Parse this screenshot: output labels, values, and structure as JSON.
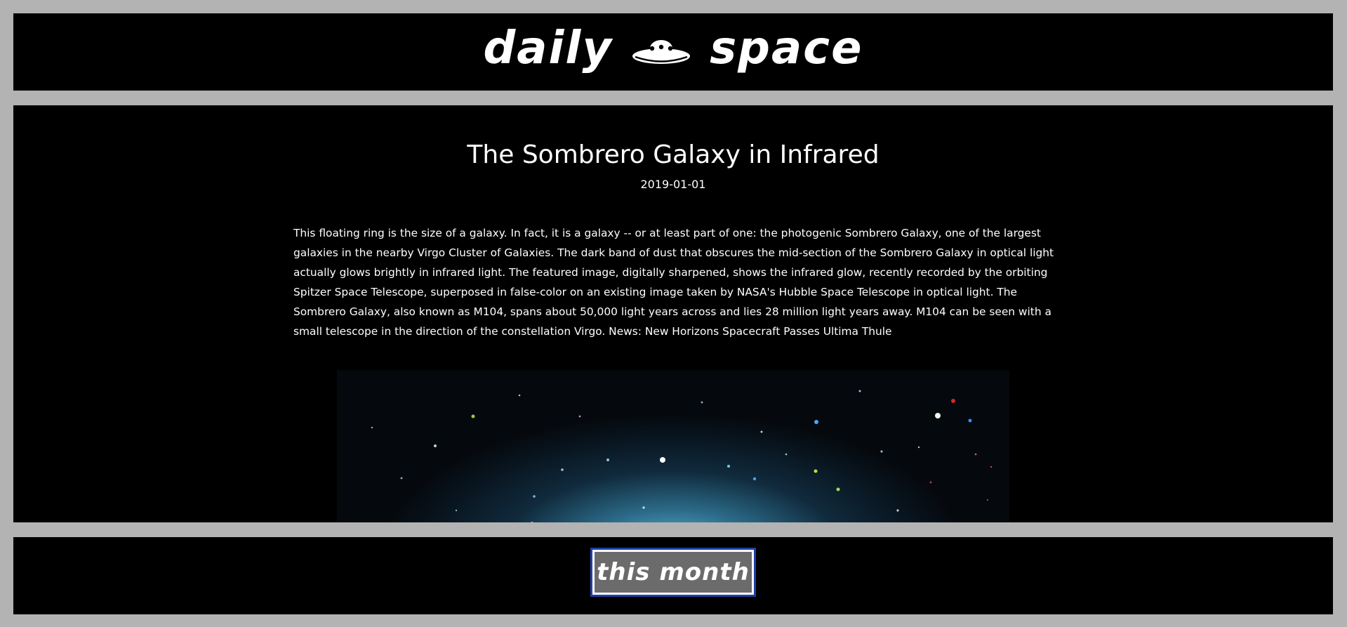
{
  "header": {
    "logo_left": "daily",
    "logo_icon": "ufo-icon",
    "logo_right": "space"
  },
  "article": {
    "title": "The Sombrero Galaxy in Infrared",
    "date": "2019-01-01",
    "explanation": "This floating ring is the size of a galaxy. In fact, it is a galaxy -- or at least part of one: the photogenic Sombrero Galaxy, one of the largest galaxies in the nearby Virgo Cluster of Galaxies. The dark band of dust that obscures the mid-section of the Sombrero Galaxy in optical light actually glows brightly in infrared light. The featured image, digitally sharpened, shows the infrared glow, recently recorded by the orbiting Spitzer Space Telescope, superposed in false-color on an existing image taken by NASA's Hubble Space Telescope in optical light. The Sombrero Galaxy, also known as M104, spans about 50,000 light years across and lies 28 million light years away. M104 can be seen with a small telescope in the direction of the constellation Virgo. News: New Horizons Spacecraft Passes Ultima Thule"
  },
  "footer": {
    "button_label": "this month"
  },
  "colors": {
    "page_background": "#b3b3b3",
    "panel_background": "#000000",
    "button_background": "#6b6b6b",
    "button_focus_outline": "#1f3fa8"
  }
}
